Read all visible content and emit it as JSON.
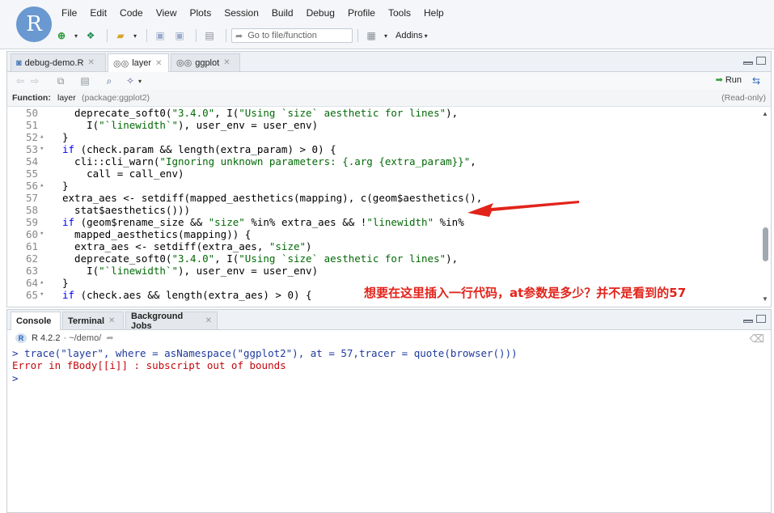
{
  "logo_letter": "R",
  "menu": [
    "File",
    "Edit",
    "Code",
    "View",
    "Plots",
    "Session",
    "Build",
    "Debug",
    "Profile",
    "Tools",
    "Help"
  ],
  "toolbar": {
    "goto_placeholder": "Go to file/function",
    "addins_label": "Addins"
  },
  "editor": {
    "tabs": [
      {
        "label": "debug-demo.R",
        "active": false
      },
      {
        "label": "layer",
        "active": true
      },
      {
        "label": "ggplot",
        "active": false
      }
    ],
    "run_label": "Run",
    "function_bar": {
      "label": "Function:",
      "name": "layer",
      "package": "(package:ggplot2)",
      "readonly": "(Read-only)"
    },
    "lines": [
      {
        "n": "50",
        "fold": "",
        "code": "  deprecate_soft0(\"3.4.0\", I(\"Using `size` aesthetic for lines\"),"
      },
      {
        "n": "51",
        "fold": "",
        "code": "    I(\"`linewidth`\"), user_env = user_env)"
      },
      {
        "n": "52",
        "fold": "▴",
        "code": "}"
      },
      {
        "n": "53",
        "fold": "▾",
        "code": "if (check.param && length(extra_param) > 0) {"
      },
      {
        "n": "54",
        "fold": "",
        "code": "  cli::cli_warn(\"Ignoring unknown parameters: {.arg {extra_param}}\","
      },
      {
        "n": "55",
        "fold": "",
        "code": "    call = call_env)"
      },
      {
        "n": "56",
        "fold": "▴",
        "code": "}"
      },
      {
        "n": "57",
        "fold": "",
        "code": "extra_aes <- setdiff(mapped_aesthetics(mapping), c(geom$aesthetics(),"
      },
      {
        "n": "58",
        "fold": "",
        "code": "  stat$aesthetics()))"
      },
      {
        "n": "59",
        "fold": "",
        "code": "if (geom$rename_size && \"size\" %in% extra_aes && !\"linewidth\" %in%"
      },
      {
        "n": "60",
        "fold": "▾",
        "code": "  mapped_aesthetics(mapping)) {"
      },
      {
        "n": "61",
        "fold": "",
        "code": "  extra_aes <- setdiff(extra_aes, \"size\")"
      },
      {
        "n": "62",
        "fold": "",
        "code": "  deprecate_soft0(\"3.4.0\", I(\"Using `size` aesthetic for lines\"),"
      },
      {
        "n": "63",
        "fold": "",
        "code": "    I(\"`linewidth`\"), user_env = user_env)"
      },
      {
        "n": "64",
        "fold": "▴",
        "code": "}"
      },
      {
        "n": "65",
        "fold": "▾",
        "code": "if (check.aes && length(extra_aes) > 0) {"
      }
    ]
  },
  "annotation": "想要在这里插入一行代码，at参数是多少？并不是看到的57",
  "console": {
    "tabs": [
      {
        "label": "Console",
        "active": true
      },
      {
        "label": "Terminal",
        "active": false
      },
      {
        "label": "Background Jobs",
        "active": false
      }
    ],
    "r_version": "R 4.2.2",
    "working_dir": "· ~/demo/",
    "lines": [
      {
        "type": "cmd",
        "text": "> trace(\"layer\", where = asNamespace(\"ggplot2\"), at = 57,tracer = quote(browser()))"
      },
      {
        "type": "error",
        "text": "Error in fBody[[i]] : subscript out of bounds"
      },
      {
        "type": "prompt",
        "text": ">"
      }
    ]
  },
  "colors": {
    "keyword": "#0000ff",
    "string": "#036a07",
    "annotation": "#e2231a",
    "error": "#c5060b"
  }
}
